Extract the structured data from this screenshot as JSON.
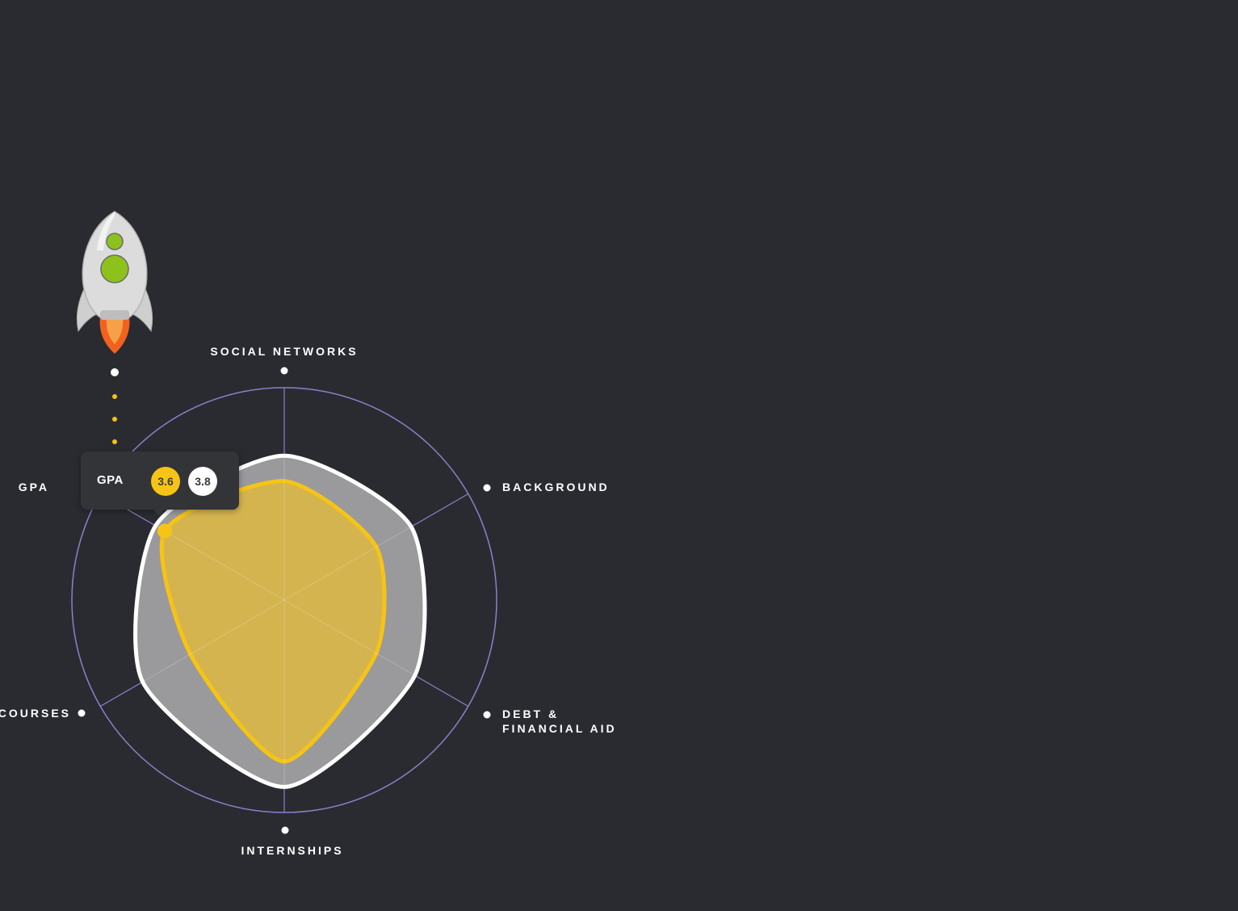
{
  "colors": {
    "background": "#2a2b31",
    "ring": "#8c7fc8",
    "yours_series": "#f6c415",
    "yours_fill": "#d4b44f",
    "benchmark_series": "#ffffff",
    "benchmark_fill": "#9a9a9d",
    "rocket_body": "#dcdcdc",
    "rocket_window": "#8cc21b",
    "rocket_flame": "#f2621f"
  },
  "icons": {
    "rocket": "rocket-icon"
  },
  "chart_data": {
    "type": "radar",
    "axes": [
      "SOCIAL NETWORKS",
      "BACKGROUND",
      "DEBT & FINANCIAL AID",
      "INTERNSHIPS",
      "COURSES",
      "GPA"
    ],
    "axis_label_lines": [
      [
        "SOCIAL NETWORKS"
      ],
      [
        "BACKGROUND"
      ],
      [
        "DEBT &",
        "FINANCIAL AID"
      ],
      [
        "INTERNSHIPS"
      ],
      [
        "COURSES"
      ],
      [
        "GPA"
      ]
    ],
    "range": [
      0,
      1
    ],
    "series": [
      {
        "role": "benchmark",
        "values": [
          0.68,
          0.69,
          0.71,
          0.88,
          0.77,
          0.7
        ]
      },
      {
        "role": "yours",
        "values": [
          0.56,
          0.5,
          0.5,
          0.76,
          0.51,
          0.65
        ]
      }
    ],
    "gridlines": true,
    "tooltip": {
      "axis": "GPA",
      "label": "GPA",
      "yours_value": "3.6",
      "benchmark_value": "3.8"
    }
  }
}
